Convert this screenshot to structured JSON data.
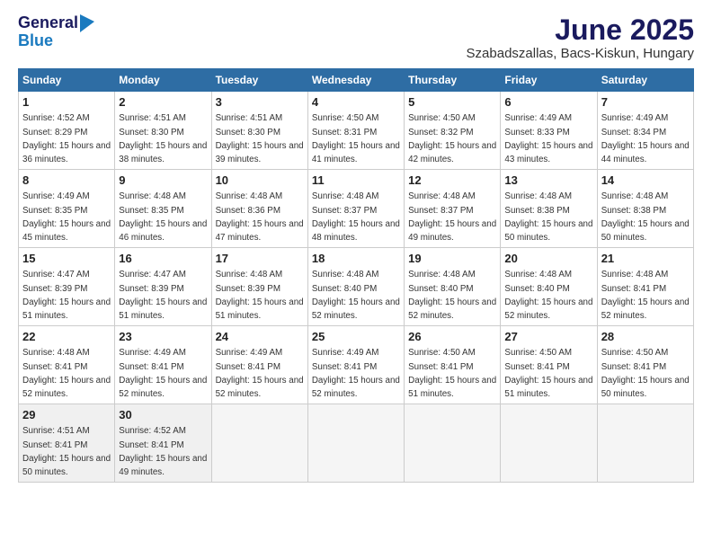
{
  "header": {
    "logo_line1": "General",
    "logo_line2": "Blue",
    "title": "June 2025",
    "subtitle": "Szabadszallas, Bacs-Kiskun, Hungary"
  },
  "weekdays": [
    "Sunday",
    "Monday",
    "Tuesday",
    "Wednesday",
    "Thursday",
    "Friday",
    "Saturday"
  ],
  "weeks": [
    [
      {
        "day": "1",
        "sunrise": "Sunrise: 4:52 AM",
        "sunset": "Sunset: 8:29 PM",
        "daylight": "Daylight: 15 hours and 36 minutes."
      },
      {
        "day": "2",
        "sunrise": "Sunrise: 4:51 AM",
        "sunset": "Sunset: 8:30 PM",
        "daylight": "Daylight: 15 hours and 38 minutes."
      },
      {
        "day": "3",
        "sunrise": "Sunrise: 4:51 AM",
        "sunset": "Sunset: 8:30 PM",
        "daylight": "Daylight: 15 hours and 39 minutes."
      },
      {
        "day": "4",
        "sunrise": "Sunrise: 4:50 AM",
        "sunset": "Sunset: 8:31 PM",
        "daylight": "Daylight: 15 hours and 41 minutes."
      },
      {
        "day": "5",
        "sunrise": "Sunrise: 4:50 AM",
        "sunset": "Sunset: 8:32 PM",
        "daylight": "Daylight: 15 hours and 42 minutes."
      },
      {
        "day": "6",
        "sunrise": "Sunrise: 4:49 AM",
        "sunset": "Sunset: 8:33 PM",
        "daylight": "Daylight: 15 hours and 43 minutes."
      },
      {
        "day": "7",
        "sunrise": "Sunrise: 4:49 AM",
        "sunset": "Sunset: 8:34 PM",
        "daylight": "Daylight: 15 hours and 44 minutes."
      }
    ],
    [
      {
        "day": "8",
        "sunrise": "Sunrise: 4:49 AM",
        "sunset": "Sunset: 8:35 PM",
        "daylight": "Daylight: 15 hours and 45 minutes."
      },
      {
        "day": "9",
        "sunrise": "Sunrise: 4:48 AM",
        "sunset": "Sunset: 8:35 PM",
        "daylight": "Daylight: 15 hours and 46 minutes."
      },
      {
        "day": "10",
        "sunrise": "Sunrise: 4:48 AM",
        "sunset": "Sunset: 8:36 PM",
        "daylight": "Daylight: 15 hours and 47 minutes."
      },
      {
        "day": "11",
        "sunrise": "Sunrise: 4:48 AM",
        "sunset": "Sunset: 8:37 PM",
        "daylight": "Daylight: 15 hours and 48 minutes."
      },
      {
        "day": "12",
        "sunrise": "Sunrise: 4:48 AM",
        "sunset": "Sunset: 8:37 PM",
        "daylight": "Daylight: 15 hours and 49 minutes."
      },
      {
        "day": "13",
        "sunrise": "Sunrise: 4:48 AM",
        "sunset": "Sunset: 8:38 PM",
        "daylight": "Daylight: 15 hours and 50 minutes."
      },
      {
        "day": "14",
        "sunrise": "Sunrise: 4:48 AM",
        "sunset": "Sunset: 8:38 PM",
        "daylight": "Daylight: 15 hours and 50 minutes."
      }
    ],
    [
      {
        "day": "15",
        "sunrise": "Sunrise: 4:47 AM",
        "sunset": "Sunset: 8:39 PM",
        "daylight": "Daylight: 15 hours and 51 minutes."
      },
      {
        "day": "16",
        "sunrise": "Sunrise: 4:47 AM",
        "sunset": "Sunset: 8:39 PM",
        "daylight": "Daylight: 15 hours and 51 minutes."
      },
      {
        "day": "17",
        "sunrise": "Sunrise: 4:48 AM",
        "sunset": "Sunset: 8:39 PM",
        "daylight": "Daylight: 15 hours and 51 minutes."
      },
      {
        "day": "18",
        "sunrise": "Sunrise: 4:48 AM",
        "sunset": "Sunset: 8:40 PM",
        "daylight": "Daylight: 15 hours and 52 minutes."
      },
      {
        "day": "19",
        "sunrise": "Sunrise: 4:48 AM",
        "sunset": "Sunset: 8:40 PM",
        "daylight": "Daylight: 15 hours and 52 minutes."
      },
      {
        "day": "20",
        "sunrise": "Sunrise: 4:48 AM",
        "sunset": "Sunset: 8:40 PM",
        "daylight": "Daylight: 15 hours and 52 minutes."
      },
      {
        "day": "21",
        "sunrise": "Sunrise: 4:48 AM",
        "sunset": "Sunset: 8:41 PM",
        "daylight": "Daylight: 15 hours and 52 minutes."
      }
    ],
    [
      {
        "day": "22",
        "sunrise": "Sunrise: 4:48 AM",
        "sunset": "Sunset: 8:41 PM",
        "daylight": "Daylight: 15 hours and 52 minutes."
      },
      {
        "day": "23",
        "sunrise": "Sunrise: 4:49 AM",
        "sunset": "Sunset: 8:41 PM",
        "daylight": "Daylight: 15 hours and 52 minutes."
      },
      {
        "day": "24",
        "sunrise": "Sunrise: 4:49 AM",
        "sunset": "Sunset: 8:41 PM",
        "daylight": "Daylight: 15 hours and 52 minutes."
      },
      {
        "day": "25",
        "sunrise": "Sunrise: 4:49 AM",
        "sunset": "Sunset: 8:41 PM",
        "daylight": "Daylight: 15 hours and 52 minutes."
      },
      {
        "day": "26",
        "sunrise": "Sunrise: 4:50 AM",
        "sunset": "Sunset: 8:41 PM",
        "daylight": "Daylight: 15 hours and 51 minutes."
      },
      {
        "day": "27",
        "sunrise": "Sunrise: 4:50 AM",
        "sunset": "Sunset: 8:41 PM",
        "daylight": "Daylight: 15 hours and 51 minutes."
      },
      {
        "day": "28",
        "sunrise": "Sunrise: 4:50 AM",
        "sunset": "Sunset: 8:41 PM",
        "daylight": "Daylight: 15 hours and 50 minutes."
      }
    ],
    [
      {
        "day": "29",
        "sunrise": "Sunrise: 4:51 AM",
        "sunset": "Sunset: 8:41 PM",
        "daylight": "Daylight: 15 hours and 50 minutes."
      },
      {
        "day": "30",
        "sunrise": "Sunrise: 4:52 AM",
        "sunset": "Sunset: 8:41 PM",
        "daylight": "Daylight: 15 hours and 49 minutes."
      },
      null,
      null,
      null,
      null,
      null
    ]
  ]
}
